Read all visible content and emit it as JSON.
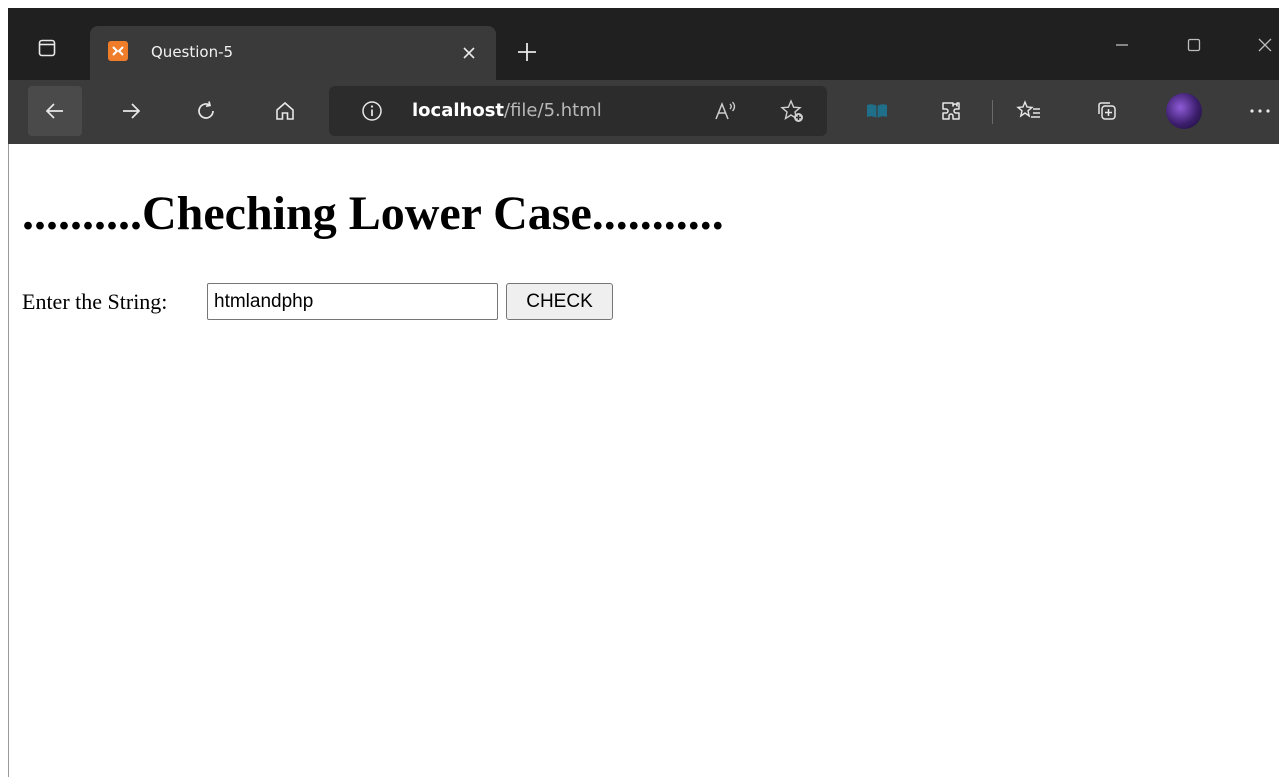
{
  "browser": {
    "tab": {
      "title": "Question-5",
      "favicon": "xampp-icon"
    },
    "address_bar": {
      "host": "localhost",
      "path": "/file/5.html"
    },
    "colors": {
      "titlebar": "#202020",
      "toolbar": "#3b3b3b",
      "tab": "#3a3a3a",
      "favicon_accent": "#f07d2a"
    },
    "toolbar_icons": [
      "back-arrow-icon",
      "forward-arrow-icon",
      "refresh-icon",
      "home-icon",
      "info-icon",
      "read-aloud-icon",
      "add-favorite-icon",
      "immersive-reader-icon",
      "extensions-icon",
      "favorites-icon",
      "collections-icon",
      "profile-avatar",
      "more-icon"
    ]
  },
  "page": {
    "heading": "..........Cheching Lower Case...........",
    "form": {
      "label": "Enter the String:",
      "input_value": "htmlandphp",
      "button_label": "CHECK"
    }
  }
}
